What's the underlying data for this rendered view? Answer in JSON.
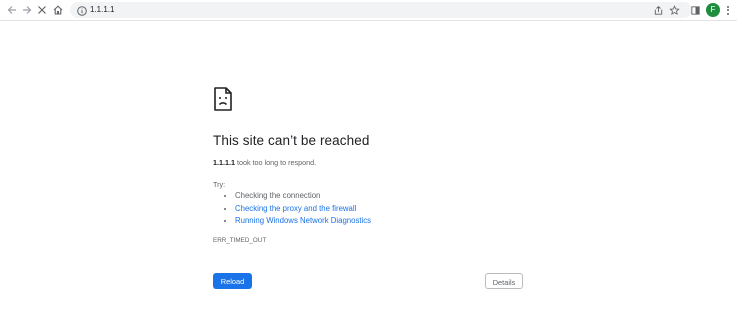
{
  "browser": {
    "address": "1.1.1.1",
    "profile_initial": "F",
    "accent_color": "#1e8e3e"
  },
  "icons": [
    "back-icon",
    "forward-icon",
    "stop-icon",
    "home-icon",
    "info-icon",
    "share-icon",
    "star-icon",
    "sidepanel-icon",
    "menu-icon",
    "sad-page-icon"
  ],
  "error": {
    "title": "This site can’t be reached",
    "host": "1.1.1.1",
    "message": " took too long to respond.",
    "try_label": "Try:",
    "suggestions": [
      "Checking the connection",
      "Checking the proxy and the firewall",
      "Running Windows Network Diagnostics"
    ],
    "code": "ERR_TIMED_OUT"
  },
  "buttons": {
    "reload": "Reload",
    "details": "Details"
  },
  "colors": {
    "primary": "#1a73e8",
    "link": "#1a73e8",
    "text": "#202124",
    "secondary_text": "#5f6368"
  }
}
